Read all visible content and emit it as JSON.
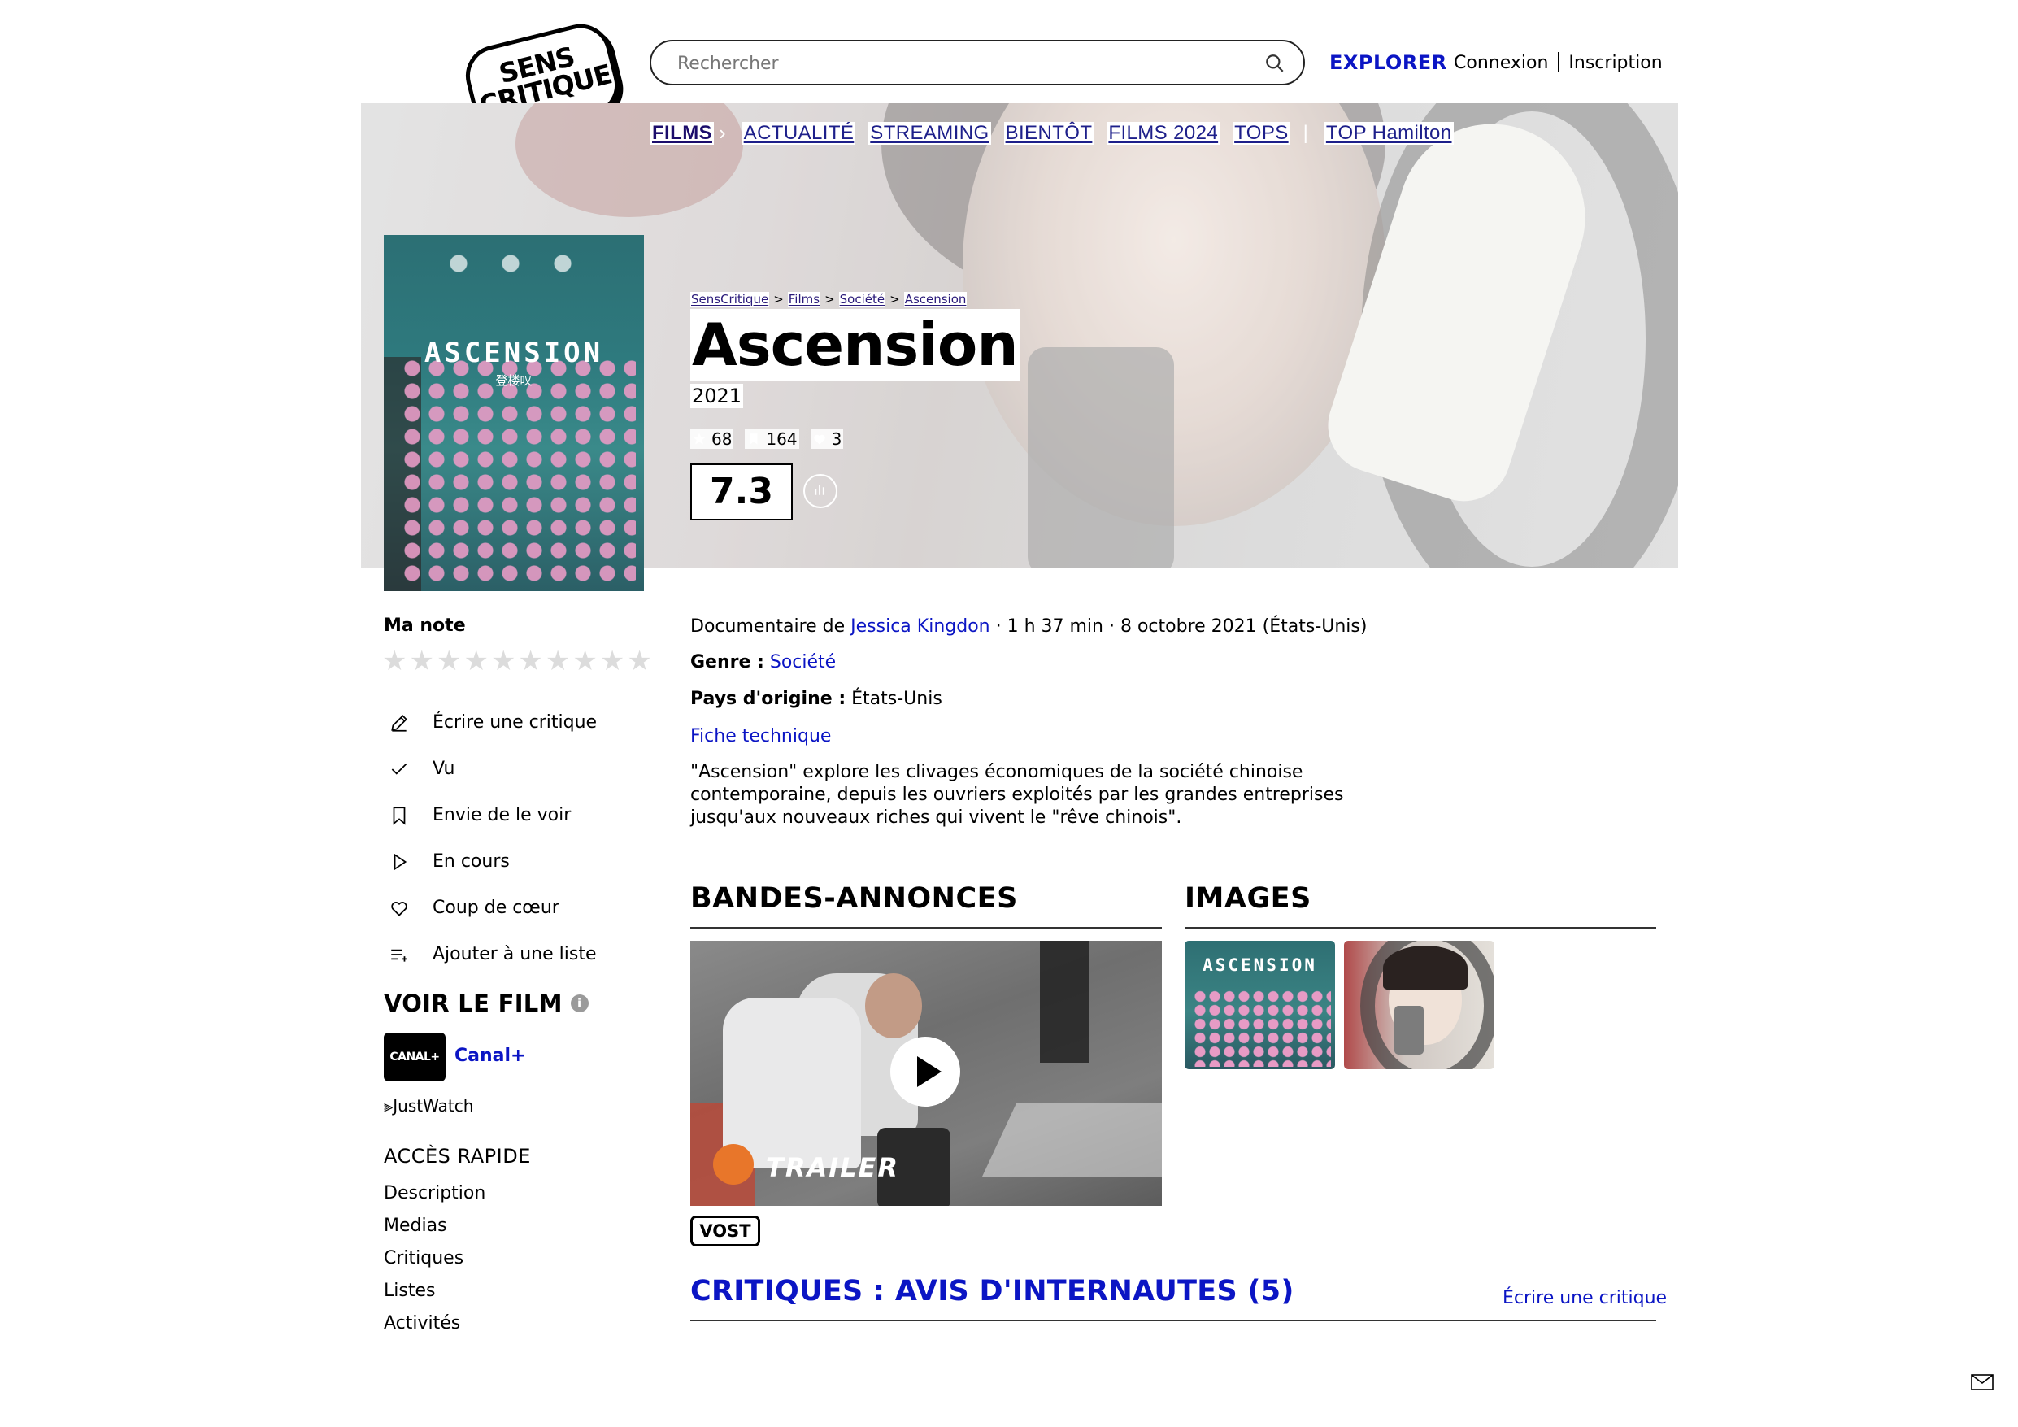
{
  "header": {
    "logo_text": "SENS CRITIQUE",
    "search_placeholder": "Rechercher",
    "explorer": "EXPLORER",
    "login": "Connexion",
    "signup": "Inscription"
  },
  "nav": {
    "first": "FILMS",
    "items": [
      "ACTUALITÉ",
      "STREAMING",
      "BIENTÔT",
      "FILMS 2024",
      "TOPS"
    ],
    "extra": "TOP Hamilton"
  },
  "breadcrumb": [
    "SensCritique",
    "Films",
    "Société",
    "Ascension"
  ],
  "film": {
    "title": "Ascension",
    "year": "2021",
    "stats": {
      "ratings": "68",
      "wishlist": "164",
      "favorites": "3"
    },
    "score": "7.3",
    "poster_title": "ASCENSION",
    "poster_subtitle": "登楼叹",
    "meta_prefix": "Documentaire de ",
    "director": "Jessica Kingdon",
    "meta_suffix": " · 1 h 37 min · 8 octobre 2021 (États-Unis)",
    "genre_label": "Genre :",
    "genre": "Société",
    "country_label": "Pays d'origine :",
    "country": "États-Unis",
    "fiche": "Fiche technique",
    "synopsis": "\"Ascension\" explore les clivages économiques de la société chinoise contemporaine, depuis les ouvriers exploités par les grandes entreprises jusqu'aux nouveaux riches qui vivent le \"rêve chinois\"."
  },
  "sidebar": {
    "ma_note": "Ma note",
    "stars_count": 10,
    "actions": [
      {
        "label": "Écrire une critique",
        "icon": "pencil-icon"
      },
      {
        "label": "Vu",
        "icon": "check-icon"
      },
      {
        "label": "Envie de le voir",
        "icon": "bookmark-icon"
      },
      {
        "label": "En cours",
        "icon": "play-outline-icon"
      },
      {
        "label": "Coup de cœur",
        "icon": "heart-icon"
      },
      {
        "label": "Ajouter à une liste",
        "icon": "list-add-icon"
      }
    ],
    "voir_le_film": "VOIR LE FILM",
    "provider_logo": "CANAL+",
    "provider": "Canal+",
    "justwatch": "JustWatch",
    "acces_rapide": "ACCÈS RAPIDE",
    "quick_links": [
      "Description",
      "Medias",
      "Critiques",
      "Listes",
      "Activités"
    ]
  },
  "media": {
    "trailers_title": "BANDES-ANNONCES",
    "images_title": "IMAGES",
    "trailer_brand": "TRAILER",
    "trailer_lang": "VOST",
    "thumb1_title": "ASCENSION"
  },
  "reviews": {
    "title": "CRITIQUES : AVIS D'INTERNAUTES (5)",
    "write": "Écrire une critique"
  },
  "colors": {
    "accent": "#0b15c4",
    "nav_text": "#1d1f8a"
  }
}
